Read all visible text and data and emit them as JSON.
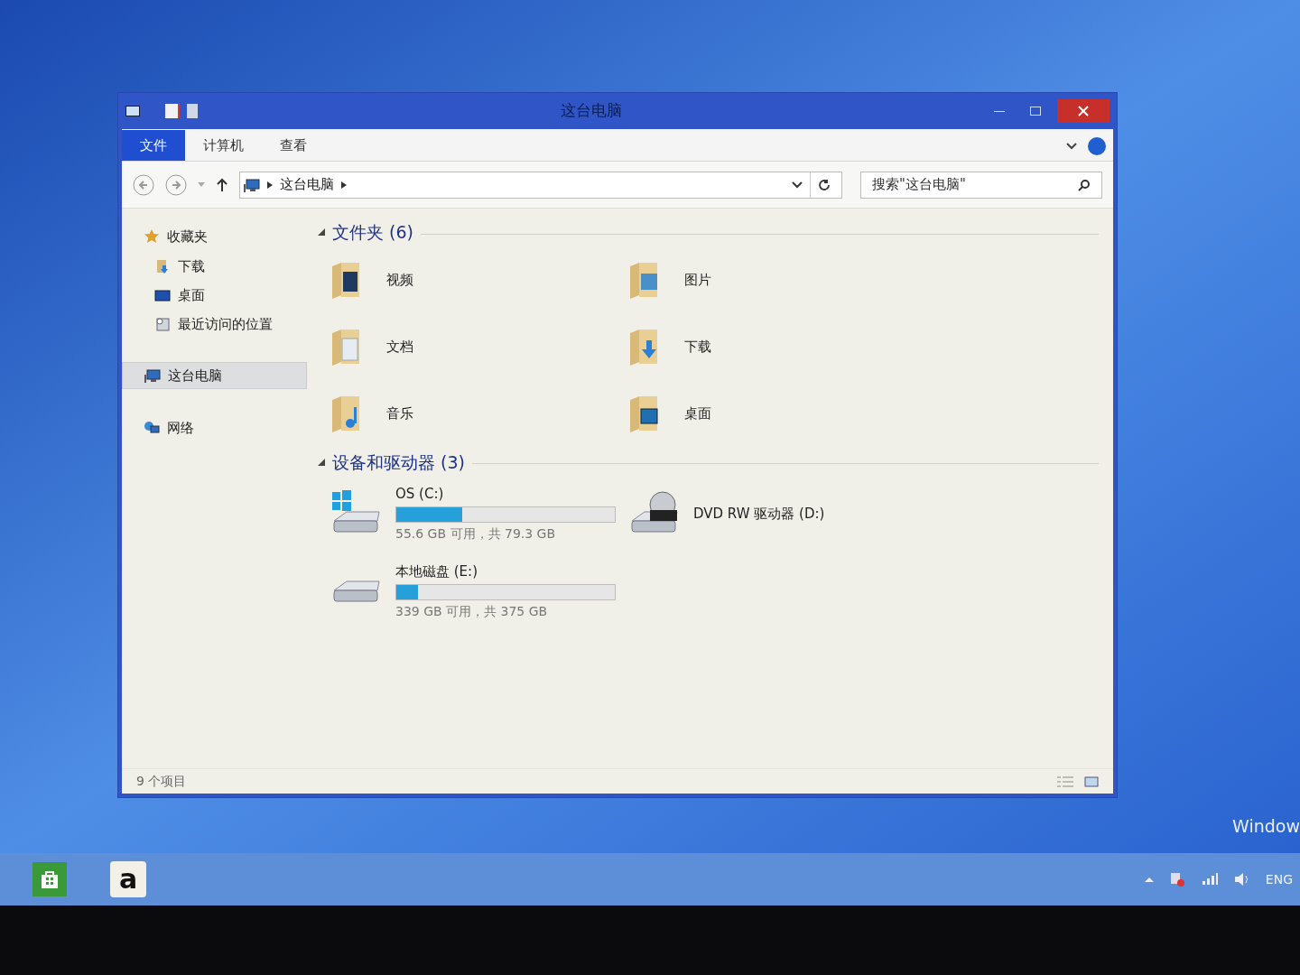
{
  "window": {
    "title": "这台电脑"
  },
  "ribbon_tabs": [
    {
      "label": "文件",
      "selected": true
    },
    {
      "label": "计算机",
      "selected": false
    },
    {
      "label": "查看",
      "selected": false
    }
  ],
  "address_bar": {
    "path": [
      "这台电脑"
    ]
  },
  "search": {
    "placeholder": "搜索\"这台电脑\""
  },
  "sidebar": {
    "groups": [
      {
        "label": "收藏夹",
        "kind": "favorites",
        "selected": false,
        "children": [
          {
            "label": "下载",
            "kind": "downloads",
            "selected": false
          },
          {
            "label": "桌面",
            "kind": "desktop",
            "selected": false
          },
          {
            "label": "最近访问的位置",
            "kind": "recent",
            "selected": false
          }
        ]
      },
      {
        "label": "这台电脑",
        "kind": "computer",
        "selected": true
      },
      {
        "label": "网络",
        "kind": "network",
        "selected": false
      }
    ]
  },
  "folders": {
    "heading": "文件夹 (6)",
    "expanded": true,
    "items": [
      {
        "label": "视频",
        "kind": "videos"
      },
      {
        "label": "图片",
        "kind": "pictures"
      },
      {
        "label": "文档",
        "kind": "documents"
      },
      {
        "label": "下载",
        "kind": "downloads"
      },
      {
        "label": "音乐",
        "kind": "music"
      },
      {
        "label": "桌面",
        "kind": "desktop"
      }
    ]
  },
  "drives": {
    "heading": "设备和驱动器 (3)",
    "expanded": true,
    "items": [
      {
        "label": "OS (C:)",
        "kind": "system",
        "level": 0.3,
        "usage": "55.6 GB 可用，共 79.3 GB"
      },
      {
        "label": "DVD RW 驱动器 (D:)",
        "kind": "dvd"
      },
      {
        "label": "本地磁盘 (E:)",
        "kind": "disk",
        "level": 0.1,
        "usage": "339 GB 可用，共 375 GB"
      }
    ]
  },
  "status_bar": {
    "item_count": "9 个项目"
  },
  "desktop": {
    "watermark_text": "Window"
  },
  "taskbar": {
    "apps": [
      {
        "kind": "store"
      },
      {
        "kind": "amazon",
        "glyph": "a"
      }
    ],
    "language": "ENG"
  }
}
